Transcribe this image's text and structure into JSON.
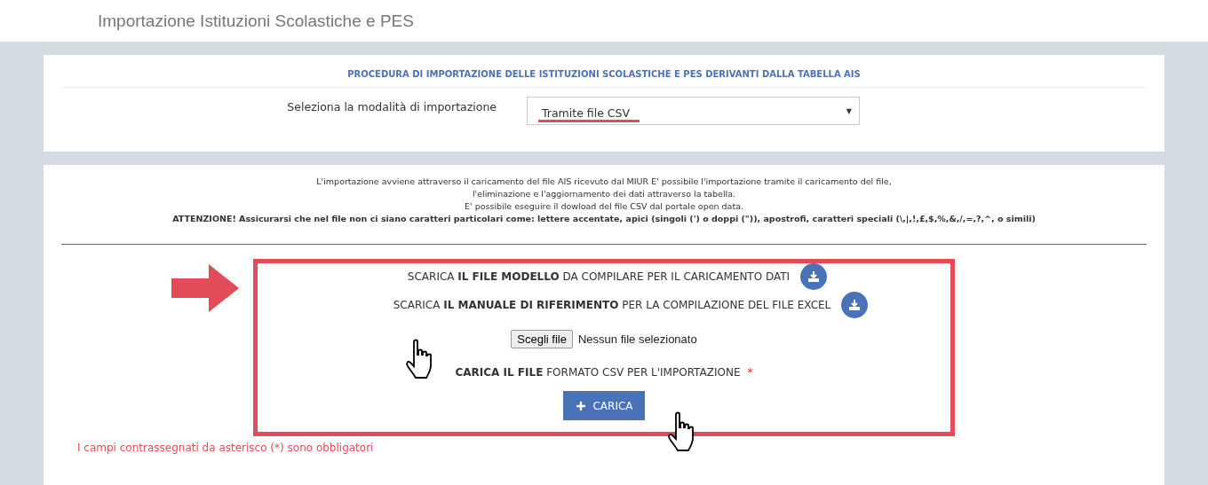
{
  "header": {
    "title": "Importazione Istituzioni Scolastiche e PES"
  },
  "procedure": {
    "heading": "PROCEDURA DI IMPORTAZIONE DELLE ISTITUZIONI SCOLASTICHE E PES DERIVANTI DALLA TABELLA AIS",
    "select_label": "Seleziona la modalità di importazione",
    "select_value": "Tramite file CSV",
    "select_caret": "▼"
  },
  "info": {
    "lines": [
      "L'importazione avviene attraverso il caricamento del file AIS ricevuto dal MIUR E' possibile l'importazione tramite il caricamento del file,",
      "l'eliminazione e l'aggiornamento dei dati attraverso la tabella.",
      "E' possibile eseguire il dowload del file CSV dal portale open data."
    ],
    "warning": "ATTENZIONE! Assicurarsi che nel file non ci siano caratteri particolari come: lettere accentate, apici (singoli (') o doppi (\")), apostrofi, caratteri speciali (\\,|,!,£,$,%,&,/,=,?,^, o simili)"
  },
  "downloads": [
    {
      "label": "SCARICA **IL FILE MODELLO** DA COMPILARE PER IL CARICAMENTO DATI"
    },
    {
      "label": "SCARICA **IL MANUALE DI RIFERIMENTO** PER LA COMPILAZIONE DEL FILE EXCEL"
    }
  ],
  "file_input": {
    "button": "Scegli file",
    "status": "Nessun file selezionato"
  },
  "upload": {
    "label": "**CARICA IL FILE** FORMATO CSV PER L'IMPORTAZIONE",
    "required": "*",
    "button": "CARICA"
  },
  "note": "I campi contrassegnati da asterisco (*) sono obbligatori"
}
